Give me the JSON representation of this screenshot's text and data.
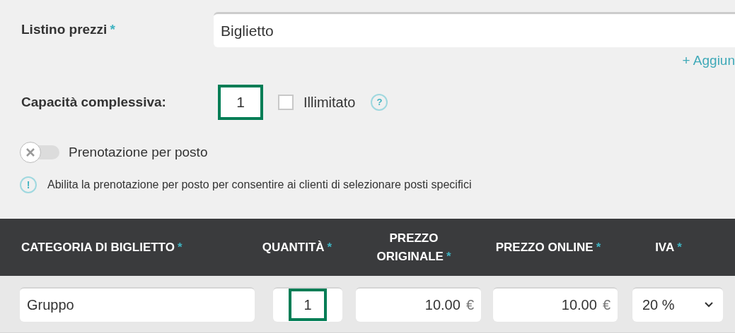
{
  "price_list": {
    "label": "Listino prezzi",
    "required_mark": "*",
    "value": "Biglietto",
    "add_link": "+ Aggiun"
  },
  "capacity": {
    "label": "Capacità complessiva:",
    "value": "1",
    "highlighted": true,
    "unlimited_label": "Illimitato",
    "unlimited_checked": false,
    "help": "?"
  },
  "seat_booking": {
    "label": "Prenotazione per posto",
    "on": false,
    "info": "!",
    "hint": "Abilita la prenotazione per posto per consentire ai clienti di selezionare posti specifici"
  },
  "table": {
    "columns": [
      {
        "label": "CATEGORIA DI BIGLIETTO",
        "required_mark": "*"
      },
      {
        "label": "QUANTITÀ",
        "required_mark": "*"
      },
      {
        "label": "PREZZO ORIGINALE",
        "required_mark": "*"
      },
      {
        "label": "PREZZO ONLINE",
        "required_mark": "*"
      },
      {
        "label": "IVA",
        "required_mark": "*"
      }
    ],
    "rows": [
      {
        "category": "Gruppo",
        "quantity": "1",
        "quantity_highlighted": true,
        "original_price": "10.00",
        "original_currency": "€",
        "online_price": "10.00",
        "online_currency": "€",
        "vat": "20 %"
      }
    ]
  }
}
